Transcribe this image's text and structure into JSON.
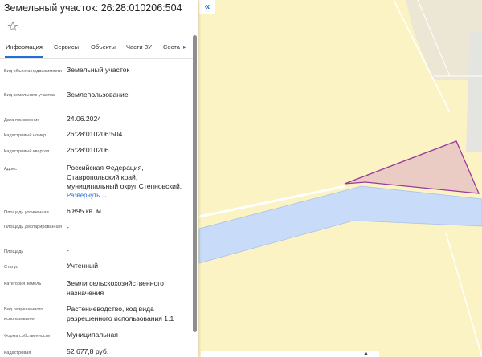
{
  "panel": {
    "title": "Земельный участок: 26:28:010206:504",
    "tabs": [
      {
        "label": "Информация"
      },
      {
        "label": "Сервисы"
      },
      {
        "label": "Объекты"
      },
      {
        "label": "Части ЗУ"
      },
      {
        "label": "Соста"
      }
    ],
    "tabs_more_icon": "chevron-right-icon",
    "expand_label": "Развернуть",
    "collapse_icon": "double-chevron-left-icon",
    "rows": [
      {
        "label": "Вид объекта недвижимости",
        "value": "Земельный участок"
      },
      {
        "label": "Вид земельного участка",
        "value": "Землепользование"
      },
      {
        "label": "Дата присвоения",
        "value": "24.06.2024"
      },
      {
        "label": "Кадастровый номер",
        "value": "26:28:010206:504"
      },
      {
        "label": "Кадастровый квартал",
        "value": "26:28:010206"
      },
      {
        "label": "Адрес",
        "value": "Российская Федерация, Ставропольский край, муниципальный округ Степновский,"
      },
      {
        "label": "Площадь уточненная",
        "value": "6 895 кв. м"
      },
      {
        "label": "Площадь декларированная",
        "value": "-"
      },
      {
        "label": "Площадь",
        "value": "-"
      },
      {
        "label": "Статус",
        "value": "Учтенный"
      },
      {
        "label": "Категория земель",
        "value": "Земли сельскохозяйственного назначения"
      },
      {
        "label": "Вид разрешенного использования",
        "value": "Растениеводство, код вида разрешенного использования 1.1"
      },
      {
        "label": "Форма собственности",
        "value": "Муниципальная"
      },
      {
        "label": "Кадастровая",
        "value": "52 677,8 руб."
      }
    ]
  },
  "colors": {
    "accent": "#1e6fd9",
    "map_land": "#fbf3c4",
    "map_water": "#c8dbf9",
    "parcel_fill": "#e9c8c4",
    "parcel_stroke": "#9a3a9c"
  }
}
